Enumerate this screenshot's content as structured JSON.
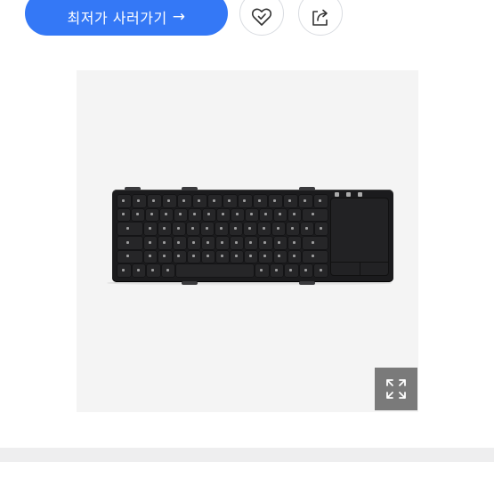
{
  "actions": {
    "cheapest_button": {
      "label": "최저가 사러가기",
      "arrow": "→"
    },
    "like_button": {
      "icon": "heart-check-icon"
    },
    "share_button": {
      "icon": "share-arrow-icon"
    }
  },
  "product_image": {
    "subject": "folding-keyboard-with-touchpad-image",
    "expand_icon": "expand-arrows-icon"
  },
  "colors": {
    "primary": "#3478f6",
    "image_background": "#f4f4f4",
    "expand_button": "#7a7a7a",
    "separator": "#eeeeef"
  }
}
